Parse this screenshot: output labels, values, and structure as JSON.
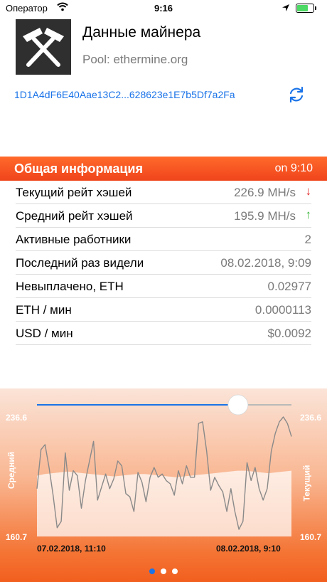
{
  "status_bar": {
    "carrier": "Оператор",
    "time": "9:16",
    "battery_level": 0.7
  },
  "header": {
    "title": "Данные майнера",
    "pool": "Pool: ethermine.org",
    "wallet": "1D1A4dF6E40Aae13C2...628623e1E7b5Df7a2Fa"
  },
  "section": {
    "title": "Общая информация",
    "updated": "on 9:10"
  },
  "rows": [
    {
      "label": "Текущий рейт хэшей",
      "value": "226.9 MH/s",
      "trend": "↓"
    },
    {
      "label": "Средний рейт хэшей",
      "value": "195.9 MH/s",
      "trend": "↑"
    },
    {
      "label": "Активные работники",
      "value": "2"
    },
    {
      "label": "Последний раз видели",
      "value": "08.02.2018, 9:09"
    },
    {
      "label": "Невыплачено, ETH",
      "value": "0.02977"
    },
    {
      "label": "ETH / мин",
      "value": "0.0000113"
    },
    {
      "label": "USD / мин",
      "value": "$0.0092"
    }
  ],
  "chart": {
    "y_max_label": "236.6",
    "y_min_label": "160.7",
    "left_axis_label": "Средний",
    "right_axis_label": "Текущий",
    "start_date": "07.02.2018, 11:10",
    "end_date": "08.02.2018, 9:10",
    "slider_value": 0.79,
    "page_count": 3,
    "active_page": 0
  },
  "chart_data": {
    "type": "line",
    "ylim": [
      160.7,
      236.6
    ],
    "series": [
      {
        "name": "Средний",
        "type": "area",
        "values": [
          198,
          199,
          199.5,
          200,
          200.5,
          200,
          199.5,
          199,
          198.5,
          198,
          197.5,
          198,
          198.5,
          199,
          199,
          198.5,
          198,
          197.5,
          197,
          197.5,
          198,
          198.5,
          199,
          199.5,
          200,
          200.5,
          201,
          201,
          200.5,
          200,
          199.5,
          200,
          200.5,
          201
        ]
      },
      {
        "name": "Текущий",
        "type": "line",
        "values": [
          190,
          214,
          217,
          203,
          186,
          166,
          170,
          212,
          189,
          201,
          198,
          178,
          195,
          207,
          219,
          183,
          191,
          199,
          190,
          196,
          207,
          204,
          187,
          185,
          176,
          200,
          194,
          182,
          197,
          203,
          197,
          199,
          195,
          193,
          186,
          201,
          193,
          204,
          197,
          197,
          230,
          231,
          213,
          189,
          197,
          192,
          188,
          176,
          190,
          176,
          165,
          170,
          206,
          195,
          203,
          190,
          183,
          190,
          213,
          224,
          231,
          234,
          230,
          222
        ]
      }
    ]
  }
}
